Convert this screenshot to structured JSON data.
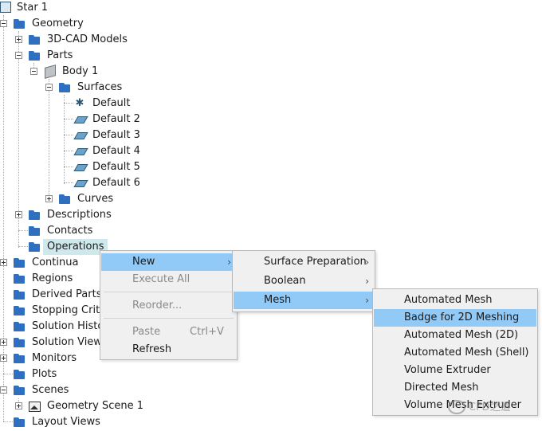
{
  "tree": {
    "star": "Star 1",
    "geometry": "Geometry",
    "cad_models": "3D-CAD Models",
    "parts": "Parts",
    "body": "Body 1",
    "surfaces": "Surfaces",
    "surface_items": [
      "Default",
      "Default 2",
      "Default 3",
      "Default 4",
      "Default 5",
      "Default 6"
    ],
    "curves": "Curves",
    "descriptions": "Descriptions",
    "contacts": "Contacts",
    "operations": "Operations",
    "continua": "Continua",
    "regions": "Regions",
    "derived_parts": "Derived Parts",
    "stopping_criteria": "Stopping Crite",
    "solution_histories": "Solution Histo",
    "solution_views": "Solution View",
    "monitors": "Monitors",
    "plots": "Plots",
    "scenes": "Scenes",
    "geometry_scene": "Geometry Scene 1",
    "layout_views": "Layout Views"
  },
  "context_menu": {
    "new": "New",
    "execute_all": "Execute All",
    "reorder": "Reorder...",
    "paste": "Paste",
    "paste_shortcut": "Ctrl+V",
    "refresh": "Refresh"
  },
  "new_submenu": {
    "surface_preparation": "Surface Preparation",
    "boolean": "Boolean",
    "mesh": "Mesh"
  },
  "mesh_submenu": [
    "Automated Mesh",
    "Badge for 2D Meshing",
    "Automated Mesh (2D)",
    "Automated Mesh (Shell)",
    "Volume Extruder",
    "Directed Mesh",
    "Volume Mesh Extruder"
  ],
  "watermark": "CFD之道",
  "colors": {
    "menu_highlight": "#91c9f7",
    "tree_selection": "#cfe8ec",
    "folder": "#2f6fc0"
  }
}
